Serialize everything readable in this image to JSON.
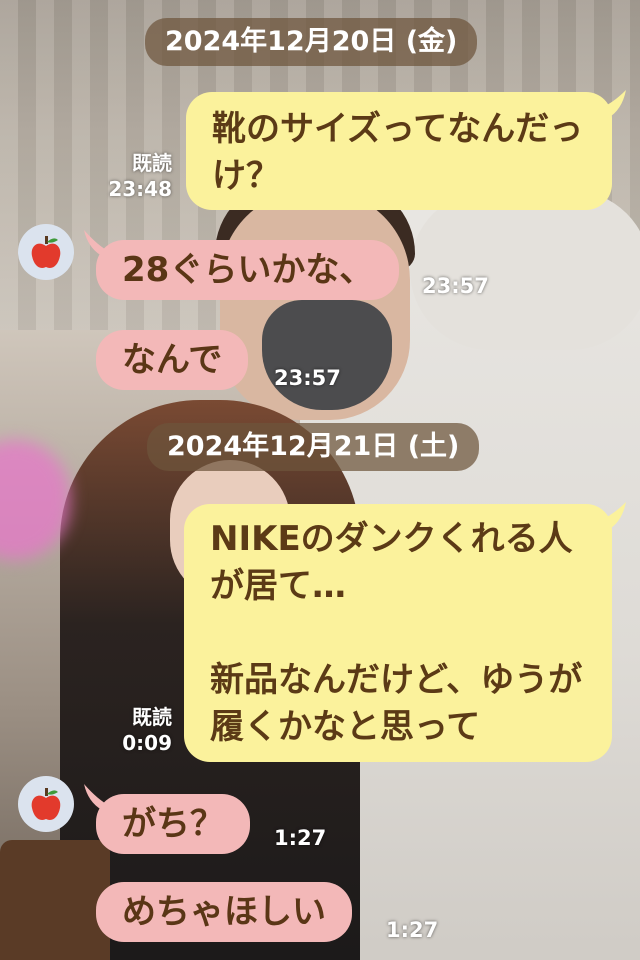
{
  "dates": [
    "2024年12月20日 (金)",
    "2024年12月21日 (土)"
  ],
  "messages": [
    {
      "dir": "out",
      "text": "靴のサイズってなんだっけ？",
      "read": "既読",
      "time": "23:48"
    },
    {
      "dir": "in",
      "text": "28ぐらいかな、",
      "time": "23:57"
    },
    {
      "dir": "in",
      "text": "なんで",
      "time": "23:57"
    },
    {
      "dir": "out",
      "text": "NIKEのダンクくれる人が居て…\n\n新品なんだけど、ゆうが履くかなと思って",
      "read": "既読",
      "time": "0:09"
    },
    {
      "dir": "in",
      "text": "がち？",
      "time": "1:27"
    },
    {
      "dir": "in",
      "text": "めちゃほしい",
      "time": "1:27"
    }
  ],
  "colors": {
    "outgoing_bubble": "#fbf29c",
    "incoming_bubble": "#f3b8b8",
    "text": "#5a3616",
    "date_chip": "#6e553c"
  },
  "avatar_icon": "apple-icon"
}
